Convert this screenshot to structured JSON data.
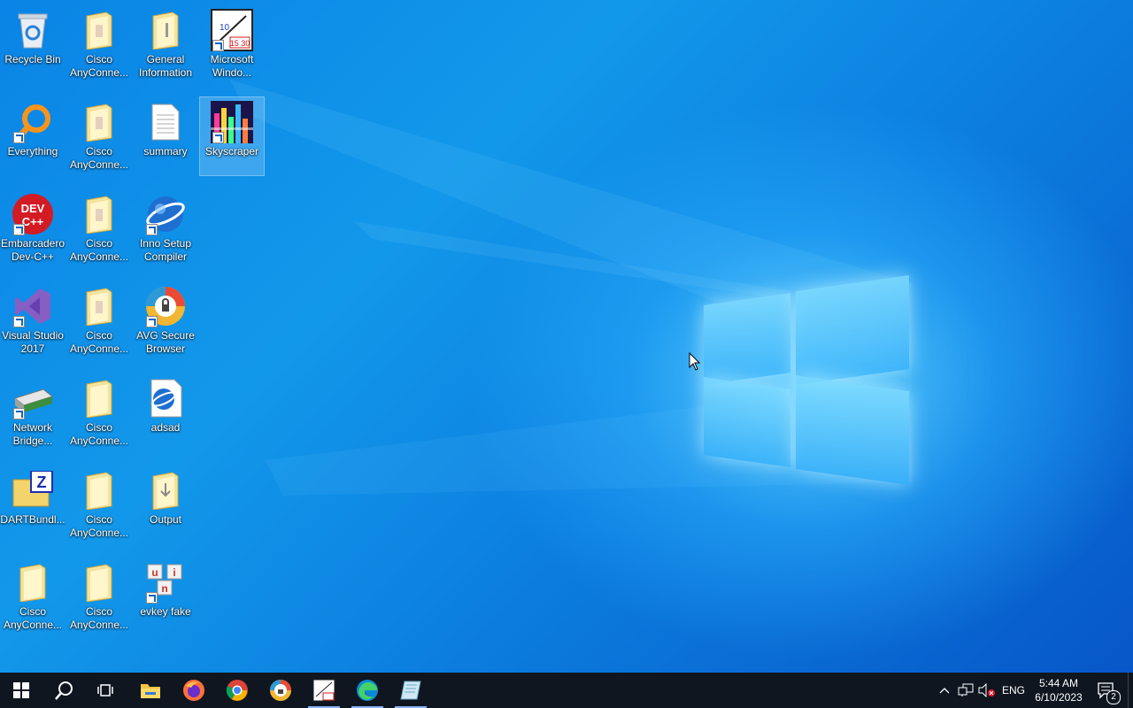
{
  "desktop": {
    "icons": [
      {
        "label": "Recycle Bin",
        "icon": "recycle-bin-icon"
      },
      {
        "label": "Cisco\nAnyConne...",
        "icon": "folder-icon"
      },
      {
        "label": "General\nInformation",
        "icon": "folder-icon"
      },
      {
        "label": "Microsoft\nWindo...",
        "icon": "app-shortcut-icon"
      },
      {
        "label": "Everything",
        "icon": "everything-search-icon"
      },
      {
        "label": "Cisco\nAnyConne...",
        "icon": "folder-icon"
      },
      {
        "label": "summary",
        "icon": "text-document-icon"
      },
      {
        "label": "Skyscraper",
        "icon": "skyscraper-app-icon"
      },
      {
        "label": "Embarcadero\nDev-C++",
        "icon": "devcpp-icon"
      },
      {
        "label": "Cisco\nAnyConne...",
        "icon": "folder-icon"
      },
      {
        "label": "Inno Setup\nCompiler",
        "icon": "inno-setup-icon"
      },
      {
        "label": "Visual Studio\n2017",
        "icon": "visual-studio-icon"
      },
      {
        "label": "Cisco\nAnyConne...",
        "icon": "folder-icon"
      },
      {
        "label": "AVG Secure\nBrowser",
        "icon": "avg-browser-icon"
      },
      {
        "label": "Network\nBridge...",
        "icon": "network-bridge-icon"
      },
      {
        "label": "Cisco\nAnyConne...",
        "icon": "folder-icon"
      },
      {
        "label": "adsad",
        "icon": "inno-script-icon"
      },
      {
        "label": "DARTBundl...",
        "icon": "dart-bundle-icon"
      },
      {
        "label": "Cisco\nAnyConne...",
        "icon": "folder-icon"
      },
      {
        "label": "Output",
        "icon": "folder-icon"
      },
      {
        "label": "Cisco\nAnyConne...",
        "icon": "folder-icon"
      },
      {
        "label": "Cisco\nAnyConne...",
        "icon": "folder-icon"
      },
      {
        "label": "evkey fake",
        "icon": "evkey-icon"
      }
    ],
    "selected": "Skyscraper"
  },
  "taskbar": {
    "buttons": [
      "start-icon",
      "search-icon",
      "task-view-icon",
      "file-explorer-icon",
      "firefox-icon",
      "chrome-icon",
      "avg-browser-icon",
      "timer-app-icon",
      "edge-icon",
      "notepad-app-icon"
    ],
    "tray": {
      "language": "ENG",
      "time": "5:44 AM",
      "date": "6/10/2023",
      "notifications": "2"
    }
  }
}
